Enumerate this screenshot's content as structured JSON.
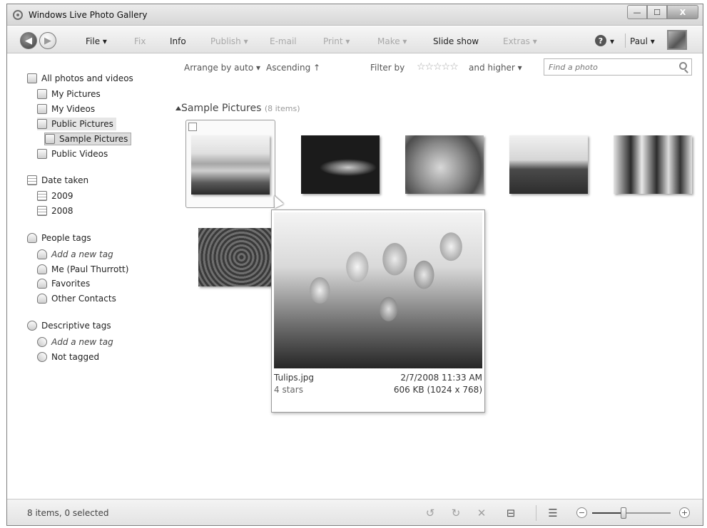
{
  "window": {
    "title": "Windows Live Photo Gallery"
  },
  "caption": {
    "minimize": "—",
    "maximize": "☐",
    "close": "X"
  },
  "toolbar": {
    "back_glyph": "◀",
    "forward_glyph": "▶",
    "menus": [
      {
        "label": "File ▾",
        "enabled": true
      },
      {
        "label": "Fix",
        "enabled": false
      },
      {
        "label": "Info",
        "enabled": true
      },
      {
        "label": "Publish ▾",
        "enabled": false
      },
      {
        "label": "E-mail",
        "enabled": false
      },
      {
        "label": "Print ▾",
        "enabled": false
      },
      {
        "label": "Make ▾",
        "enabled": false
      },
      {
        "label": "Slide show",
        "enabled": true
      },
      {
        "label": "Extras ▾",
        "enabled": false
      }
    ],
    "help": "?",
    "help_arrow": "▾",
    "user": "Paul ▾"
  },
  "sidebar": {
    "all": "All photos and videos",
    "library": [
      "My Pictures",
      "My Videos",
      "Public Pictures",
      "Sample Pictures",
      "Public Videos"
    ],
    "date_header": "Date taken",
    "dates": [
      "2009",
      "2008"
    ],
    "people_header": "People tags",
    "people": [
      "Add a new tag",
      "Me (Paul Thurrott)",
      "Favorites",
      "Other Contacts"
    ],
    "desc_header": "Descriptive tags",
    "desc": [
      "Add a new tag",
      "Not tagged"
    ]
  },
  "filterbar": {
    "arrange": "Arrange by auto ▾",
    "order": "Ascending ↑",
    "filter": "Filter by",
    "stars": "☆☆☆☆☆",
    "higher": "and higher ▾",
    "search_placeholder": "Find a photo"
  },
  "group": {
    "title": "Sample Pictures",
    "count": "(8 items)"
  },
  "preview": {
    "filename": "Tulips.jpg",
    "datetime": "2/7/2008 11:33 AM",
    "rating": "4 stars",
    "size": "606 KB (1024 x 768)"
  },
  "status": {
    "text": "8 items, 0 selected",
    "rotate_left": "↺",
    "rotate_right": "↻",
    "delete": "✕",
    "slideshow": "⊟",
    "details": "☰",
    "zoom_minus": "−",
    "zoom_plus": "+",
    "zoom_level": 0.4
  },
  "icons": {
    "back": "back-arrow-icon",
    "forward": "forward-arrow-icon",
    "help": "help-icon",
    "search": "search-icon",
    "rotate_left": "rotate-left-icon",
    "rotate_right": "rotate-right-icon",
    "delete": "delete-icon",
    "slideshow": "slideshow-icon",
    "details": "details-view-icon"
  }
}
